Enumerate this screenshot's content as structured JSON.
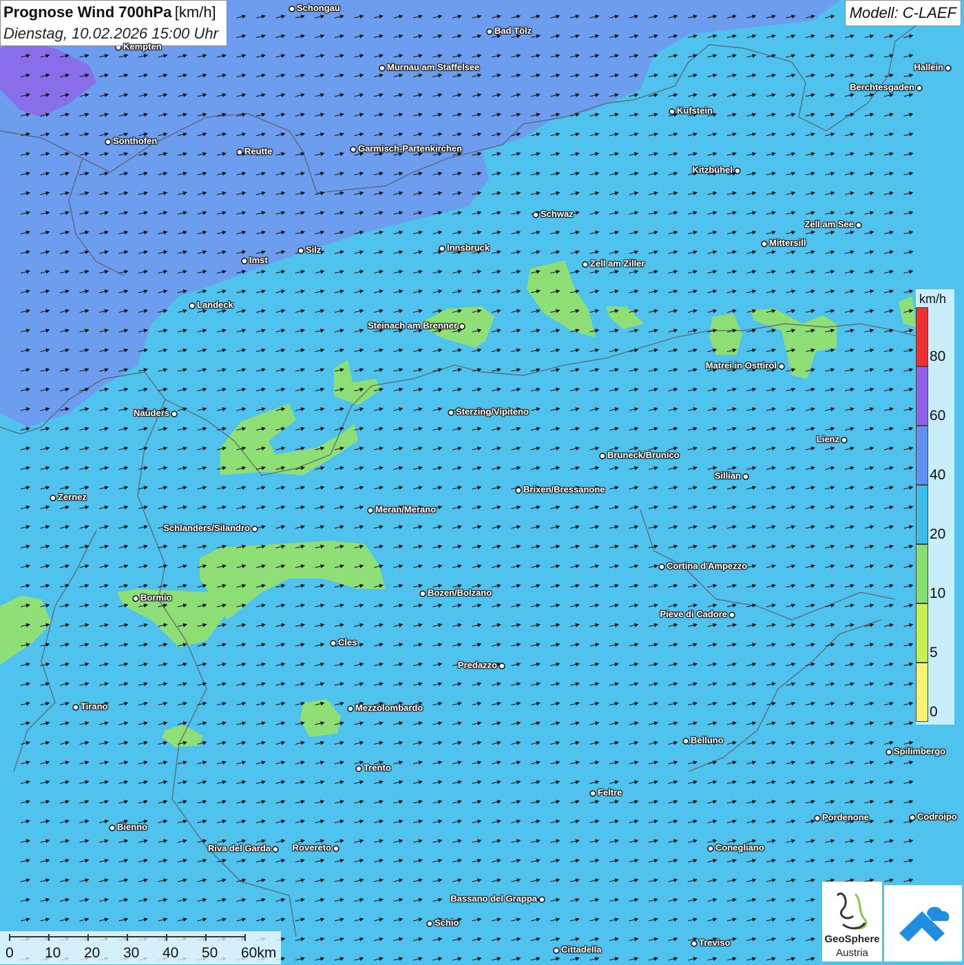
{
  "header": {
    "title": "Prognose Wind 700hPa",
    "unit": "[km/h]",
    "datetime": "Dienstag, 10.02.2026 15:00 Uhr",
    "model": "Modell: C-LAEF"
  },
  "legend": {
    "unit": "km/h",
    "labels": [
      "80",
      "60",
      "40",
      "20",
      "10",
      "5",
      "0"
    ],
    "colors": [
      "#ef3030",
      "#9060e8",
      "#6090f0",
      "#3bbfea",
      "#86e070",
      "#c8f050",
      "#f5f570"
    ]
  },
  "scale": {
    "labels": [
      "0",
      "10",
      "20",
      "30",
      "40",
      "50",
      "60km"
    ]
  },
  "logos": {
    "org_line1": "GeoSphere",
    "org_line2": "Austria"
  },
  "cities": [
    {
      "name": "Schongau"
    },
    {
      "name": "Bad Tölz"
    },
    {
      "name": "Kempten"
    },
    {
      "name": "Murnau am Staffelsee"
    },
    {
      "name": "Hallein"
    },
    {
      "name": "Berchtesgaden"
    },
    {
      "name": "Kufstein"
    },
    {
      "name": "Sonthofen"
    },
    {
      "name": "Reutte"
    },
    {
      "name": "Garmisch-Partenkirchen"
    },
    {
      "name": "Kitzbühel"
    },
    {
      "name": "Schwaz"
    },
    {
      "name": "Zell am See"
    },
    {
      "name": "Mittersill"
    },
    {
      "name": "Innsbruck"
    },
    {
      "name": "Imst"
    },
    {
      "name": "Silz"
    },
    {
      "name": "Zell am Ziller"
    },
    {
      "name": "Landeck"
    },
    {
      "name": "Steinach am Brenner"
    },
    {
      "name": "Matrei in Osttirol"
    },
    {
      "name": "Nauders"
    },
    {
      "name": "Sterzing/Vipiteno"
    },
    {
      "name": "Lienz"
    },
    {
      "name": "Bruneck/Brunico"
    },
    {
      "name": "Sillian"
    },
    {
      "name": "Zernez"
    },
    {
      "name": "Brixen/Bressanone"
    },
    {
      "name": "Meran/Merano"
    },
    {
      "name": "Schlanders/Silandro"
    },
    {
      "name": "Cortina d'Ampezzo"
    },
    {
      "name": "Bozen/Bolzano"
    },
    {
      "name": "Bormio"
    },
    {
      "name": "Pieve di Cadore"
    },
    {
      "name": "Cles"
    },
    {
      "name": "Predazzo"
    },
    {
      "name": "Tirano"
    },
    {
      "name": "Mezzolombardo"
    },
    {
      "name": "Belluno"
    },
    {
      "name": "Spilimbergo"
    },
    {
      "name": "Trento"
    },
    {
      "name": "Feltre"
    },
    {
      "name": "Pordenone"
    },
    {
      "name": "Codroipo"
    },
    {
      "name": "Bienno"
    },
    {
      "name": "Riva del Garda"
    },
    {
      "name": "Rovereto"
    },
    {
      "name": "Conegliano"
    },
    {
      "name": "Bassano del Grappa"
    },
    {
      "name": "Schio"
    },
    {
      "name": "Treviso"
    },
    {
      "name": "Cittadella"
    }
  ]
}
